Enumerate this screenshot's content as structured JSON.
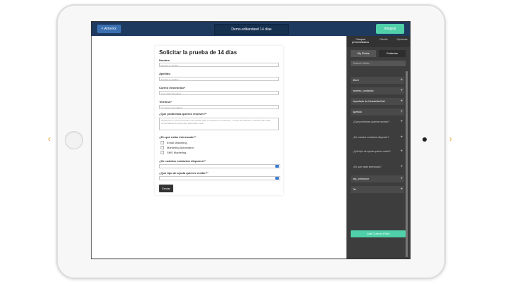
{
  "header": {
    "back_label": "< Anterior",
    "title": "Demo editandand 14 días",
    "save_label": "Integrar"
  },
  "form": {
    "title": "Solicitar la prueba de 14 días",
    "fields": {
      "nombre": {
        "label": "Nombre",
        "placeholder": "Escribe tu nombre"
      },
      "apellido": {
        "label": "Apellido",
        "placeholder": "Escribe tu apellido"
      },
      "correo": {
        "label": "Correo electrónico*",
        "placeholder": "Tu e-mail corporativo"
      },
      "telefono": {
        "label": "Teléfono*",
        "placeholder": "Tu número de teléfono"
      },
      "problemas": {
        "label": "¿Qué problemas quieres resolver?*",
        "placeholder": "Explícanos un poco si buscas una solución para tu empresa o tus clientes, y el tipo de producto o solución que estás comercializando para poder asesorarte mejor"
      },
      "interesado": {
        "label": "¿En qué estás interesado?*",
        "options": [
          "Email Marketing",
          "Marketing Automation",
          "SMS Marketing"
        ]
      },
      "contactos": {
        "label": "¿De cuántos contactos dispones?*"
      },
      "ayuda": {
        "label": "¿Qué tipo de ayuda quieres recibir?*"
      }
    },
    "submit_label": "Enviar"
  },
  "panel": {
    "tabs": [
      "Campos personalizados",
      "Diseño",
      "Opciones"
    ],
    "subtabs": [
      "My Fields",
      "Estándar"
    ],
    "search_placeholder": "Search fields...",
    "fields": [
      "Móvil",
      "numero_contactos",
      "Importado de NewsletterSoft",
      "Apellido"
    ],
    "questions": [
      "¿Qué problemas quieres resolver?",
      "¿De cuántos contactos dispones?",
      "¿Qué tipo de ayuda quieres recibir?",
      "¿En qué estás interesado?"
    ],
    "fields2": [
      "org_unbounce",
      "Tel"
    ],
    "add_label": "Add Custom Field"
  },
  "colors": {
    "topbar": "#1f3a5f",
    "accent": "#4fd0a8",
    "panel": "#3d3d3d"
  }
}
